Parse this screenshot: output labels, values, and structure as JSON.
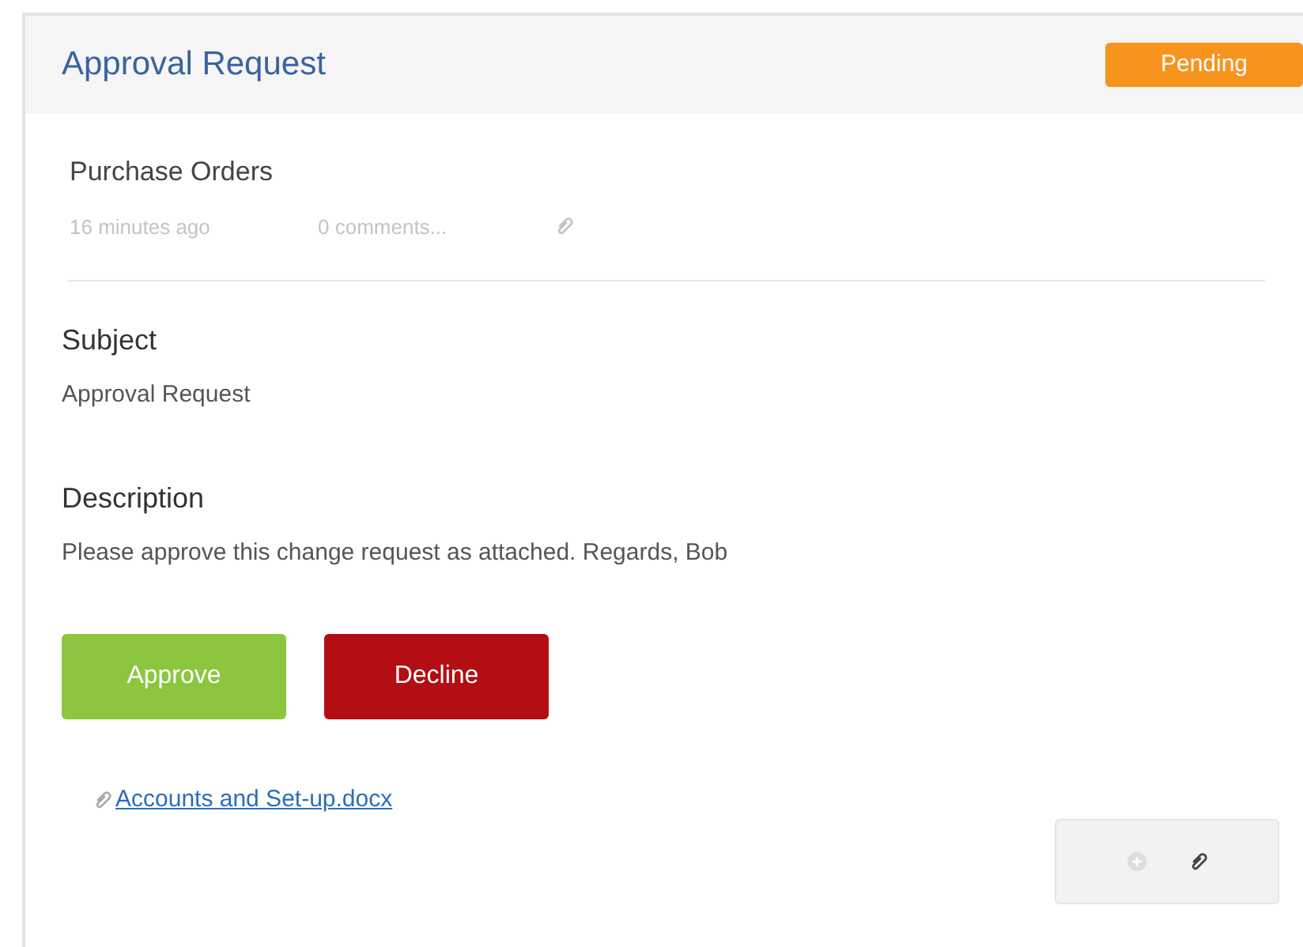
{
  "header": {
    "title": "Approval Request",
    "status": {
      "label": "Pending",
      "color": "#f7941d"
    }
  },
  "item": {
    "category": "Purchase Orders",
    "time": "16 minutes ago",
    "comments": "0 comments..."
  },
  "sections": [
    {
      "heading": "Subject",
      "text": "Approval Request"
    },
    {
      "heading": "Description",
      "text": "Please approve this change request as attached. Regards, Bob"
    }
  ],
  "actions": [
    {
      "label": "Approve",
      "kind": "approve"
    },
    {
      "label": "Decline",
      "kind": "decline"
    }
  ],
  "attachment": {
    "name": "Accounts and Set-up.docx"
  }
}
